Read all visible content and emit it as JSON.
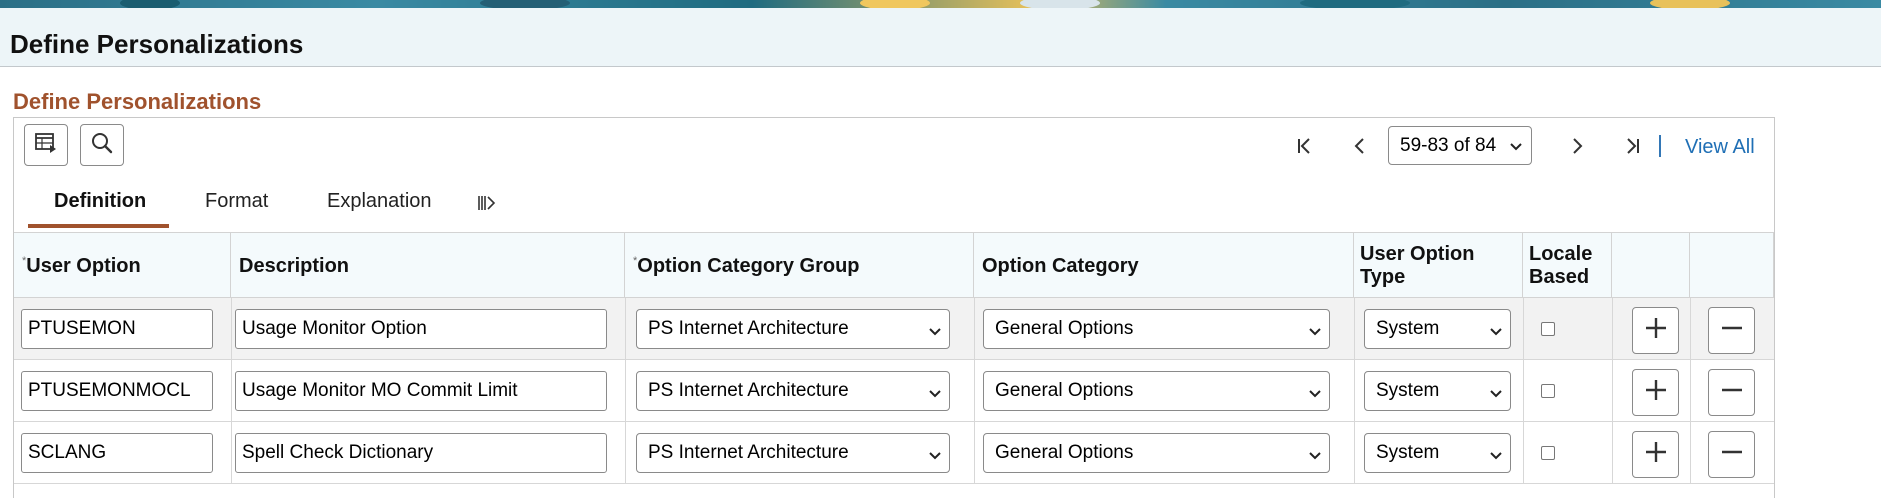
{
  "header": {
    "page_title": "Define Personalizations"
  },
  "section": {
    "title": "Define Personalizations"
  },
  "toolbar": {
    "personalize_icon": "grid-personalize-icon",
    "search_icon": "search-icon"
  },
  "pagination": {
    "range_label": "59-83 of 84",
    "view_all": "View All",
    "icons": [
      "first-page-icon",
      "previous-page-icon",
      "next-page-icon",
      "last-page-icon"
    ]
  },
  "tabs": [
    {
      "label": "Definition",
      "active": true
    },
    {
      "label": "Format",
      "active": false
    },
    {
      "label": "Explanation",
      "active": false
    }
  ],
  "columns": {
    "user_option": "User Option",
    "description": "Description",
    "option_category_group": "Option Category Group",
    "option_category": "Option Category",
    "user_option_type_1": "User Option",
    "user_option_type_2": "Type",
    "locale_based_1": "Locale",
    "locale_based_2": "Based",
    "required_marker": "*"
  },
  "rows": [
    {
      "user_option": "PTUSEMON",
      "description": "Usage Monitor Option",
      "option_category_group": "PS Internet Architecture",
      "option_category": "General Options",
      "user_option_type": "System",
      "locale_based": false
    },
    {
      "user_option": "PTUSEMONMOCL",
      "description": "Usage Monitor MO Commit Limit",
      "option_category_group": "PS Internet Architecture",
      "option_category": "General Options",
      "user_option_type": "System",
      "locale_based": false
    },
    {
      "user_option": "SCLANG",
      "description": "Spell Check Dictionary",
      "option_category_group": "PS Internet Architecture",
      "option_category": "General Options",
      "user_option_type": "System",
      "locale_based": false
    }
  ],
  "colors": {
    "accent": "#a0522d",
    "link": "#1f6fb5",
    "header_bg": "#edf5f8"
  }
}
